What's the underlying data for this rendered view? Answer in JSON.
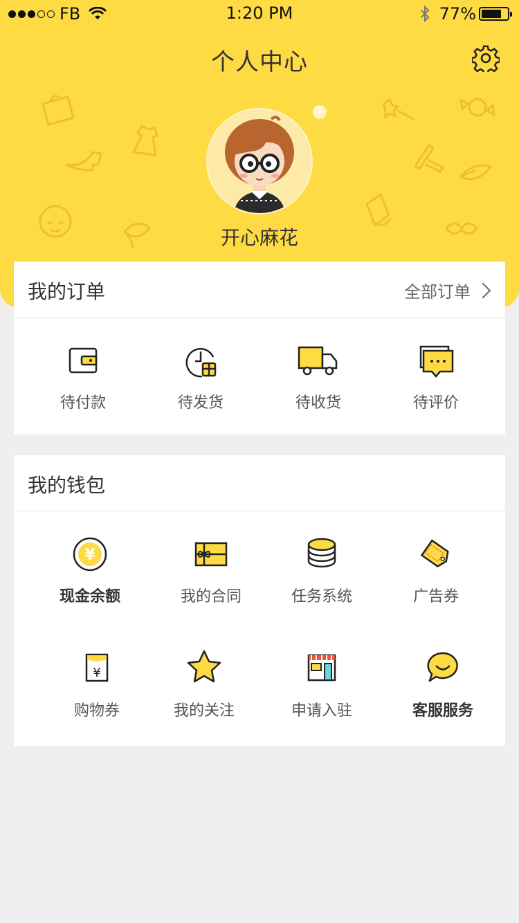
{
  "status_bar": {
    "carrier": "FB",
    "time": "1:20 PM",
    "battery": "77%",
    "battery_level": 0.77
  },
  "header": {
    "title": "个人中心",
    "username": "开心麻花"
  },
  "orders": {
    "title": "我的订单",
    "all_link": "全部订单",
    "items": [
      {
        "label": "待付款",
        "icon": "wallet-icon"
      },
      {
        "label": "待发货",
        "icon": "clock-gift-icon"
      },
      {
        "label": "待收货",
        "icon": "truck-icon"
      },
      {
        "label": "待评价",
        "icon": "chat-bubble-icon"
      }
    ]
  },
  "wallet": {
    "title": "我的钱包",
    "items": [
      {
        "label": "现金余额",
        "icon": "yen-coin-icon"
      },
      {
        "label": "我的合同",
        "icon": "gift-box-icon"
      },
      {
        "label": "任务系统",
        "icon": "coin-stack-icon"
      },
      {
        "label": "广告券",
        "icon": "coupon-tag-icon"
      },
      {
        "label": "购物券",
        "icon": "shopping-voucher-icon"
      },
      {
        "label": "我的关注",
        "icon": "star-icon"
      },
      {
        "label": "申请入驻",
        "icon": "storefront-icon"
      },
      {
        "label": "客服服务",
        "icon": "smile-bubble-icon"
      }
    ]
  },
  "colors": {
    "brand_yellow": "#fedb43",
    "background": "#efefef"
  }
}
